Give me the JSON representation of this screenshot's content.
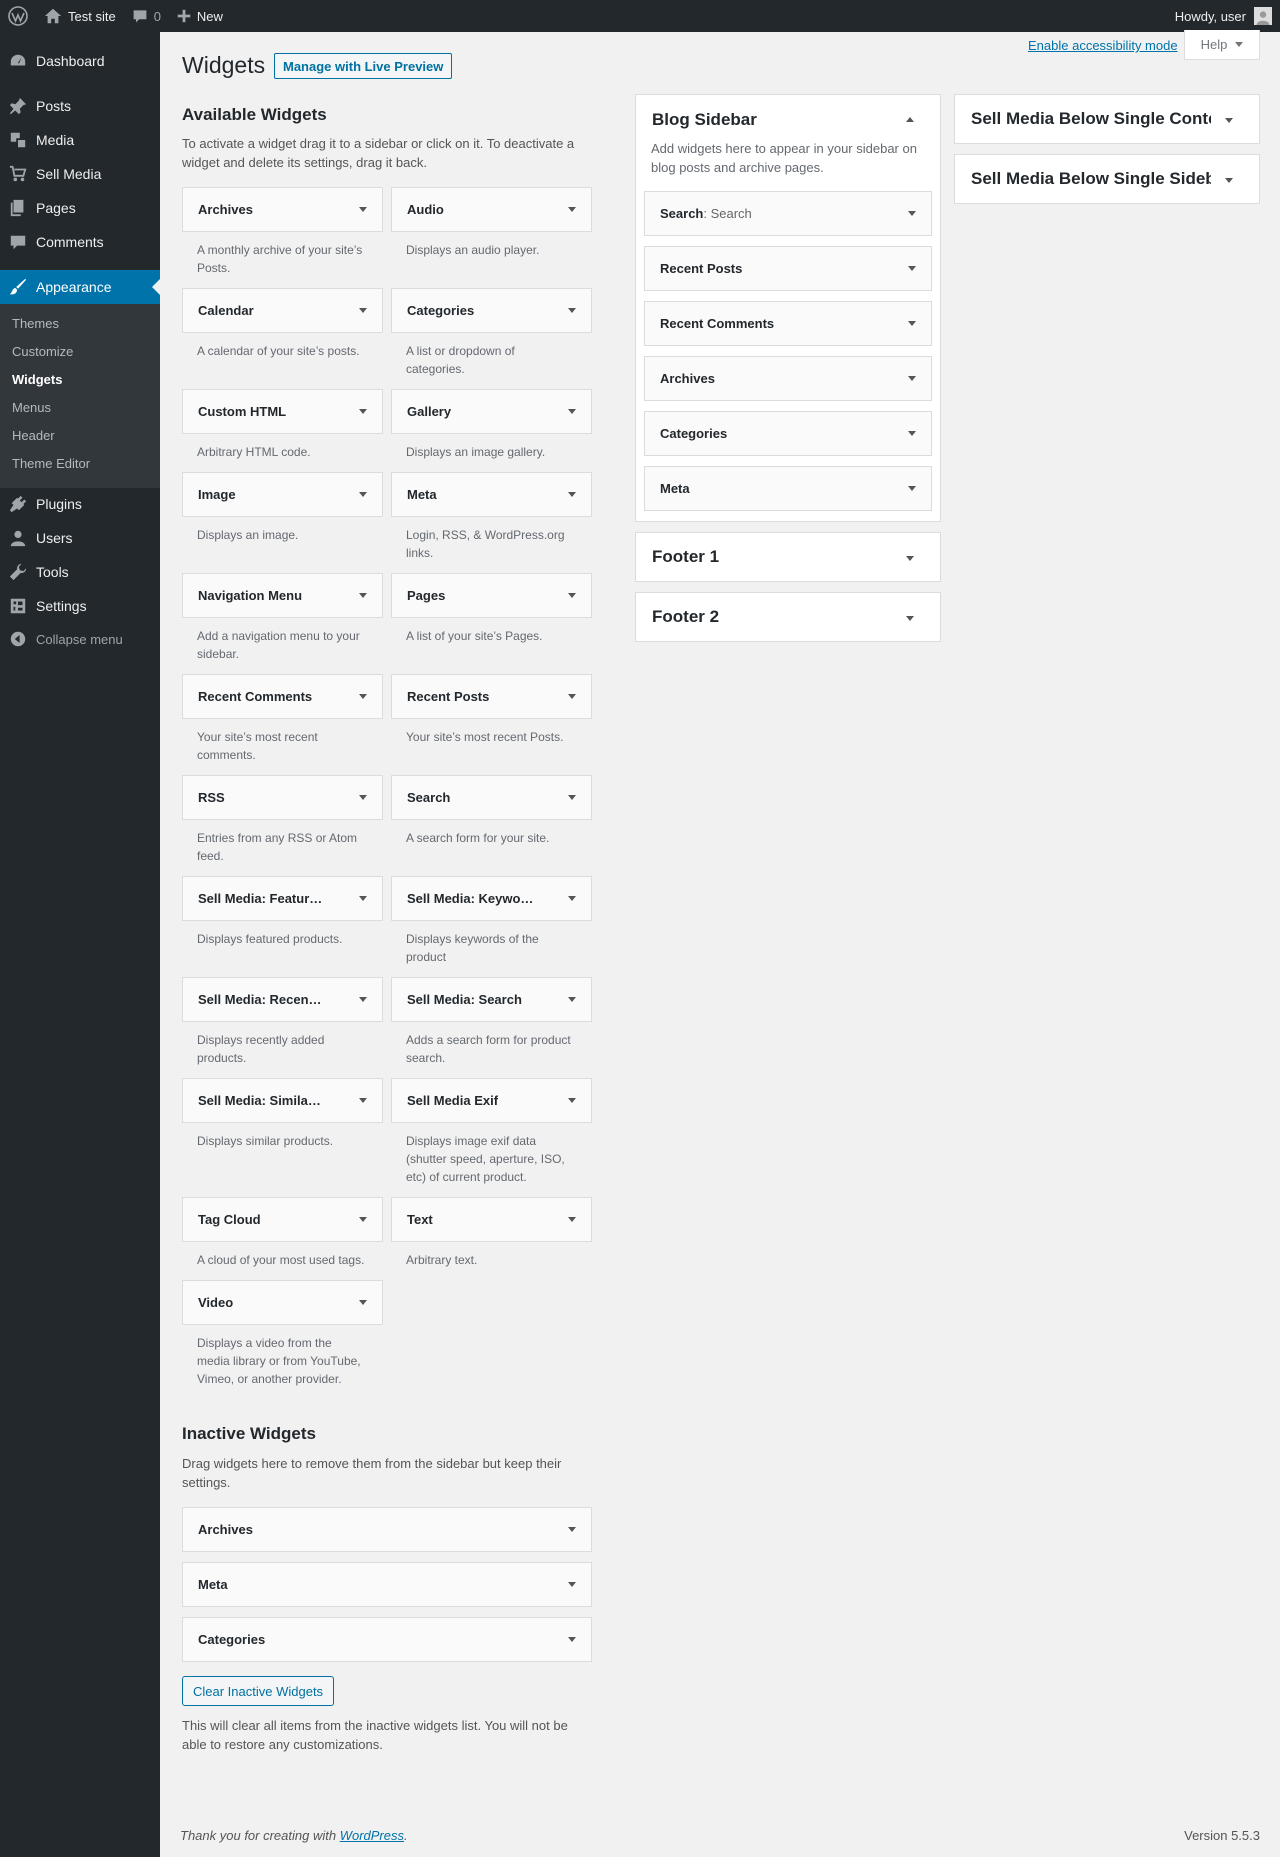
{
  "adminbar": {
    "site_name": "Test site",
    "comments_count": "0",
    "new_label": "New",
    "howdy": "Howdy, user"
  },
  "menu": {
    "items": [
      {
        "label": "Dashboard",
        "icon": "dashboard-icon"
      },
      {
        "label": "Posts",
        "icon": "pin-icon"
      },
      {
        "label": "Media",
        "icon": "media-icon"
      },
      {
        "label": "Sell Media",
        "icon": "cart-icon"
      },
      {
        "label": "Pages",
        "icon": "pages-icon"
      },
      {
        "label": "Comments",
        "icon": "comment-icon"
      },
      {
        "label": "Appearance",
        "icon": "brush-icon"
      },
      {
        "label": "Plugins",
        "icon": "plugin-icon"
      },
      {
        "label": "Users",
        "icon": "user-icon"
      },
      {
        "label": "Tools",
        "icon": "wrench-icon"
      },
      {
        "label": "Settings",
        "icon": "settings-icon"
      }
    ],
    "submenu": [
      "Themes",
      "Customize",
      "Widgets",
      "Menus",
      "Header",
      "Theme Editor"
    ],
    "collapse": "Collapse menu"
  },
  "screen_meta": {
    "a11y": "Enable accessibility mode",
    "help": "Help"
  },
  "page": {
    "title": "Widgets",
    "live_preview": "Manage with Live Preview"
  },
  "available": {
    "title": "Available Widgets",
    "description": "To activate a widget drag it to a sidebar or click on it. To deactivate a widget and delete its settings, drag it back.",
    "widgets": [
      {
        "name": "Archives",
        "desc": "A monthly archive of your site’s Posts."
      },
      {
        "name": "Audio",
        "desc": "Displays an audio player."
      },
      {
        "name": "Calendar",
        "desc": "A calendar of your site’s posts."
      },
      {
        "name": "Categories",
        "desc": "A list or dropdown of categories."
      },
      {
        "name": "Custom HTML",
        "desc": "Arbitrary HTML code."
      },
      {
        "name": "Gallery",
        "desc": "Displays an image gallery."
      },
      {
        "name": "Image",
        "desc": "Displays an image."
      },
      {
        "name": "Meta",
        "desc": "Login, RSS, & WordPress.org links."
      },
      {
        "name": "Navigation Menu",
        "desc": "Add a navigation menu to your sidebar."
      },
      {
        "name": "Pages",
        "desc": "A list of your site’s Pages."
      },
      {
        "name": "Recent Comments",
        "desc": "Your site’s most recent comments."
      },
      {
        "name": "Recent Posts",
        "desc": "Your site’s most recent Posts."
      },
      {
        "name": "RSS",
        "desc": "Entries from any RSS or Atom feed."
      },
      {
        "name": "Search",
        "desc": "A search form for your site."
      },
      {
        "name": "Sell Media: Featur…",
        "desc": "Displays featured products."
      },
      {
        "name": "Sell Media: Keywo…",
        "desc": "Displays keywords of the product"
      },
      {
        "name": "Sell Media: Recen…",
        "desc": "Displays recently added products."
      },
      {
        "name": "Sell Media: Search",
        "desc": "Adds a search form for product search."
      },
      {
        "name": "Sell Media: Simila…",
        "desc": "Displays similar products."
      },
      {
        "name": "Sell Media Exif",
        "desc": "Displays image exif data (shutter speed, aperture, ISO, etc) of current product."
      },
      {
        "name": "Tag Cloud",
        "desc": "A cloud of your most used tags."
      },
      {
        "name": "Text",
        "desc": "Arbitrary text."
      },
      {
        "name": "Video",
        "desc": "Displays a video from the media library or from YouTube, Vimeo, or another provider."
      }
    ]
  },
  "inactive": {
    "title": "Inactive Widgets",
    "description": "Drag widgets here to remove them from the sidebar but keep their settings.",
    "widgets": [
      "Archives",
      "Meta",
      "Categories"
    ],
    "clear_button": "Clear Inactive Widgets",
    "clear_note": "This will clear all items from the inactive widgets list. You will not be able to restore any customizations."
  },
  "blog_sidebar": {
    "title": "Blog Sidebar",
    "description": "Add widgets here to appear in your sidebar on blog posts and archive pages.",
    "widgets": [
      {
        "name": "Search",
        "sub": ": Search"
      },
      {
        "name": "Recent Posts",
        "sub": ""
      },
      {
        "name": "Recent Comments",
        "sub": ""
      },
      {
        "name": "Archives",
        "sub": ""
      },
      {
        "name": "Categories",
        "sub": ""
      },
      {
        "name": "Meta",
        "sub": ""
      }
    ]
  },
  "footer1": {
    "title": "Footer 1"
  },
  "footer2": {
    "title": "Footer 2"
  },
  "sell_media_content": {
    "title": "Sell Media Below Single Content"
  },
  "sell_media_sidebar": {
    "title": "Sell Media Below Single Sidebar"
  },
  "footer": {
    "thanks_prefix": "Thank you for creating with ",
    "thanks_link": "WordPress",
    "thanks_suffix": ".",
    "version": "Version 5.5.3"
  }
}
